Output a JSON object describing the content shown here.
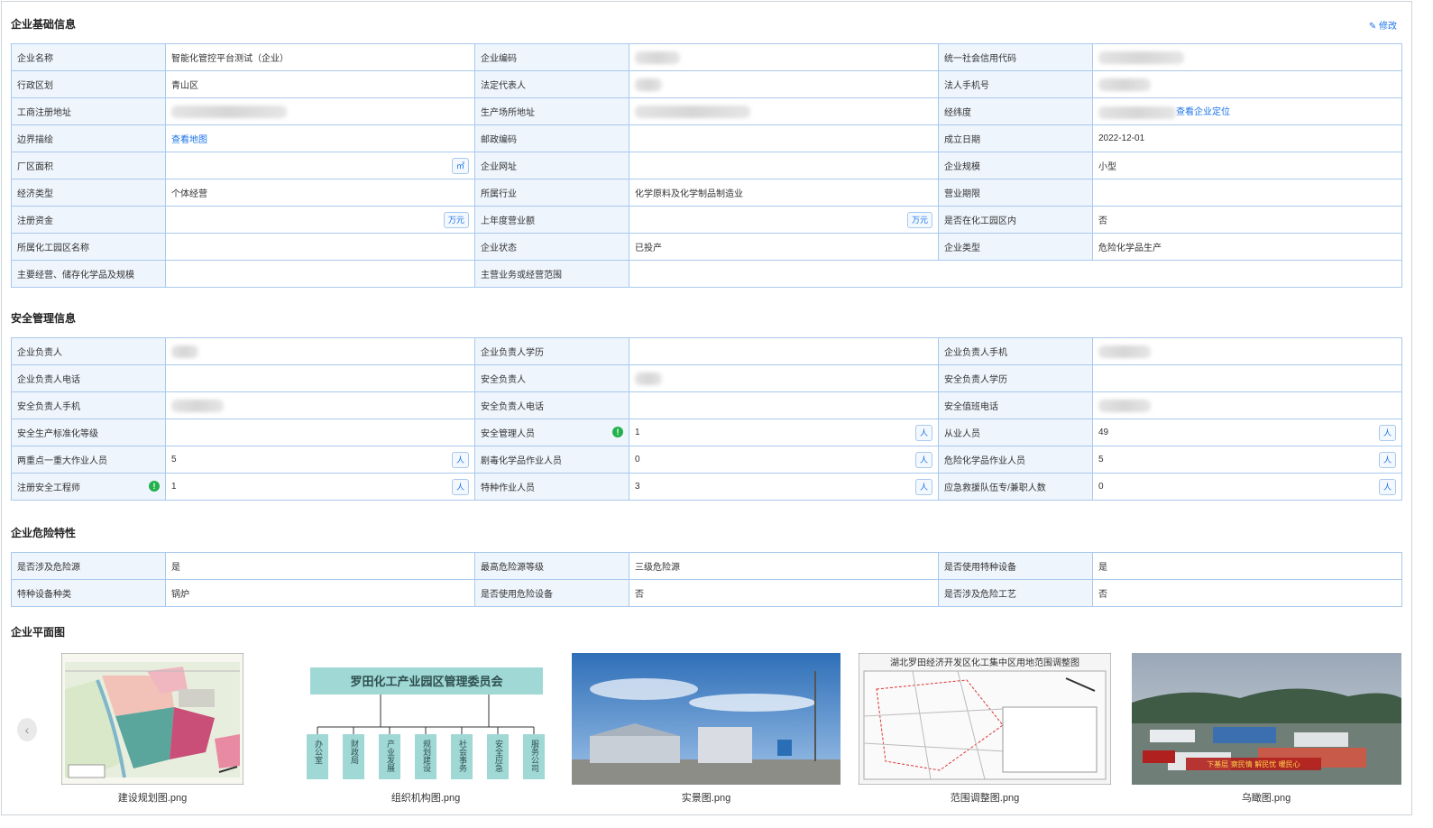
{
  "sections": {
    "basic": "企业基础信息",
    "safety": "安全管理信息",
    "hazard": "企业危险特性",
    "plan": "企业平面图"
  },
  "edit_label": "修改",
  "basic_rows": [
    [
      {
        "l": "企业名称",
        "v": "智能化管控平台测试（企业）"
      },
      {
        "l": "企业编码",
        "blur": 50
      },
      {
        "l": "统一社会信用代码",
        "blur": 95
      }
    ],
    [
      {
        "l": "行政区划",
        "v": "青山区"
      },
      {
        "l": "法定代表人",
        "blur": 30
      },
      {
        "l": "法人手机号",
        "blur": 58
      }
    ],
    [
      {
        "l": "工商注册地址",
        "blur": 128
      },
      {
        "l": "生产场所地址",
        "blur": 128
      },
      {
        "l": "经纬度",
        "blur": 86,
        "link": "查看企业定位"
      }
    ],
    [
      {
        "l": "边界描绘",
        "link": "查看地图"
      },
      {
        "l": "邮政编码",
        "v": ""
      },
      {
        "l": "成立日期",
        "v": "2022-12-01"
      }
    ],
    [
      {
        "l": "厂区面积",
        "v": "",
        "unit": "㎡"
      },
      {
        "l": "企业网址",
        "v": ""
      },
      {
        "l": "企业规模",
        "v": "小型"
      }
    ],
    [
      {
        "l": "经济类型",
        "v": "个体经营"
      },
      {
        "l": "所属行业",
        "v": "化学原料及化学制品制造业"
      },
      {
        "l": "营业期限",
        "v": ""
      }
    ],
    [
      {
        "l": "注册资金",
        "v": "",
        "unit": "万元"
      },
      {
        "l": "上年度营业额",
        "v": "",
        "unit": "万元"
      },
      {
        "l": "是否在化工园区内",
        "v": "否"
      }
    ],
    [
      {
        "l": "所属化工园区名称",
        "v": ""
      },
      {
        "l": "企业状态",
        "v": "已投产"
      },
      {
        "l": "企业类型",
        "v": "危险化学品生产"
      }
    ]
  ],
  "basic_last": {
    "l1": "主要经营、储存化学品及规模",
    "v1": "",
    "l2": "主营业务或经营范围",
    "v2": ""
  },
  "safety_rows": [
    [
      {
        "l": "企业负责人",
        "blur": 30
      },
      {
        "l": "企业负责人学历",
        "v": ""
      },
      {
        "l": "企业负责人手机",
        "blur": 58
      }
    ],
    [
      {
        "l": "企业负责人电话",
        "v": ""
      },
      {
        "l": "安全负责人",
        "blur": 30
      },
      {
        "l": "安全负责人学历",
        "v": ""
      }
    ],
    [
      {
        "l": "安全负责人手机",
        "blur": 58
      },
      {
        "l": "安全负责人电话",
        "v": ""
      },
      {
        "l": "安全值班电话",
        "blur": 58
      }
    ],
    [
      {
        "l": "安全生产标准化等级",
        "v": ""
      },
      {
        "l": "安全管理人员",
        "warn": "!",
        "v": "1",
        "unit": "人"
      },
      {
        "l": "从业人员",
        "v": "49",
        "unit": "人"
      }
    ],
    [
      {
        "l": "两重点一重大作业人员",
        "v": "5",
        "unit": "人"
      },
      {
        "l": "剧毒化学品作业人员",
        "v": "0",
        "unit": "人"
      },
      {
        "l": "危险化学品作业人员",
        "v": "5",
        "unit": "人"
      }
    ],
    [
      {
        "l": "注册安全工程师",
        "warn": "!",
        "v": "1",
        "unit": "人"
      },
      {
        "l": "特种作业人员",
        "v": "3",
        "unit": "人"
      },
      {
        "l": "应急救援队伍专/兼职人数",
        "v": "0",
        "unit": "人"
      }
    ]
  ],
  "hazard_rows": [
    [
      {
        "l": "是否涉及危险源",
        "v": "是"
      },
      {
        "l": "最高危险源等级",
        "v": "三级危险源"
      },
      {
        "l": "是否使用特种设备",
        "v": "是"
      }
    ],
    [
      {
        "l": "特种设备种类",
        "v": "锅炉"
      },
      {
        "l": "是否使用危险设备",
        "v": "否"
      },
      {
        "l": "是否涉及危险工艺",
        "v": "否"
      }
    ]
  ],
  "images": [
    {
      "name": "建设规划图.png"
    },
    {
      "name": "组织机构图.png",
      "org_title": "罗田化工产业园区管理委员会",
      "org_units": [
        "办公室",
        "财政局",
        "产业发展",
        "规划建设",
        "社会事务",
        "安全应急",
        "服务公司"
      ]
    },
    {
      "name": "实景图.png"
    },
    {
      "name": "范围调整图.png",
      "map_title": "湖北罗田经济开发区化工集中区用地范围调整图"
    },
    {
      "name": "乌瞰图.png",
      "banner": "下基层 察民情 解民忧 暖民心"
    }
  ],
  "prev_icon": "‹"
}
